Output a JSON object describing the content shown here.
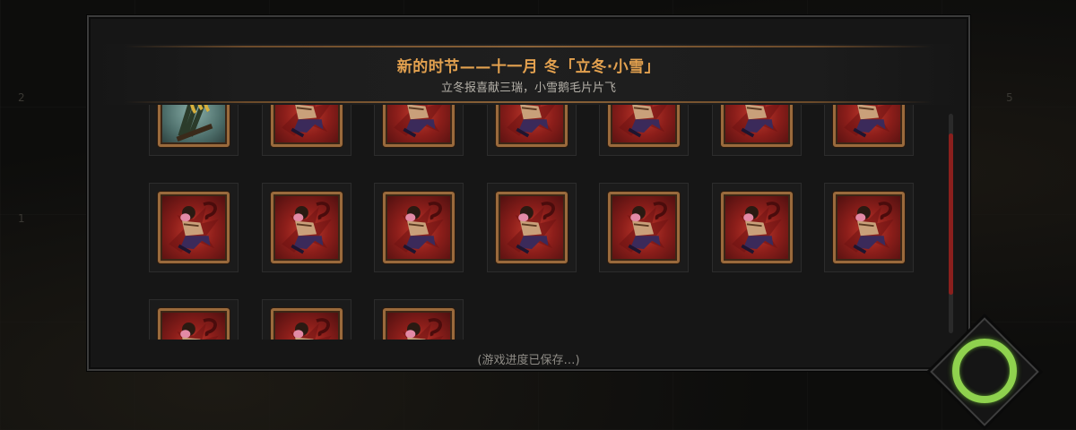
{
  "header": {
    "title": "新的时节——十一月 冬「立冬·小雪」",
    "subtitle": "立冬报喜献三瑞，小雪鹅毛片片飞"
  },
  "footer": {
    "status_text": "(游戏进度已保存…)"
  },
  "map_markers": [
    "2",
    "1",
    "5"
  ],
  "colors": {
    "title": "#e3a14f",
    "frame": "#9a6a3c",
    "card_bg": "#8c1e1a",
    "scroll_thumb": "#8a1f1d",
    "action_ring": "#8fd24e"
  },
  "items": [
    {
      "icon": "rice-sheaf-icon"
    },
    {
      "icon": "fighter-portrait-icon"
    },
    {
      "icon": "fighter-portrait-icon"
    },
    {
      "icon": "fighter-portrait-icon"
    },
    {
      "icon": "fighter-portrait-icon"
    },
    {
      "icon": "fighter-portrait-icon"
    },
    {
      "icon": "fighter-portrait-icon"
    },
    {
      "icon": "fighter-portrait-icon"
    },
    {
      "icon": "fighter-portrait-icon"
    },
    {
      "icon": "fighter-portrait-icon"
    },
    {
      "icon": "fighter-portrait-icon"
    },
    {
      "icon": "fighter-portrait-icon"
    },
    {
      "icon": "fighter-portrait-icon"
    },
    {
      "icon": "fighter-portrait-icon"
    },
    {
      "icon": "fighter-portrait-icon"
    },
    {
      "icon": "fighter-portrait-icon"
    },
    {
      "icon": "fighter-portrait-icon"
    }
  ],
  "action_button": {
    "icon": "action-ring-icon"
  }
}
